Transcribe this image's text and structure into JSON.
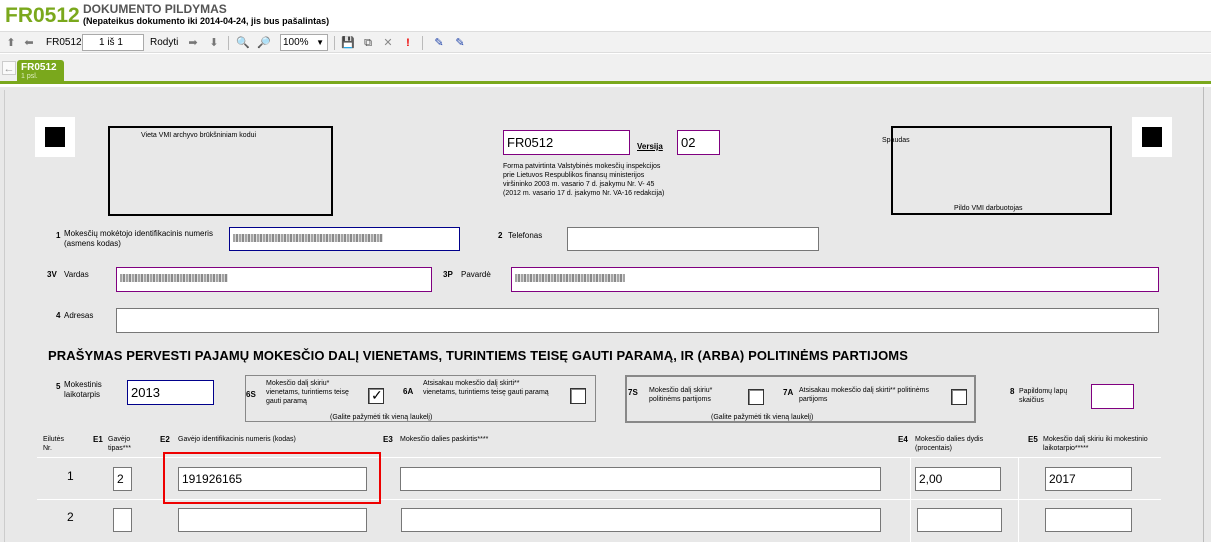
{
  "header": {
    "form_code": "FR0512",
    "title": "DOKUMENTO PILDYMAS",
    "subtitle": "(Nepateikus dokumento iki 2014-04-24, jis bus pašalintas)"
  },
  "toolbar": {
    "form_label": "FR0512",
    "page_value": "1 iš 1",
    "show_label": "Rodyti",
    "zoom_value": "100%"
  },
  "tabs": [
    {
      "label": "FR0512",
      "sub": "1 psl."
    }
  ],
  "form": {
    "archive_label": "Vieta VMI archyvo brūkšniniam kodui",
    "form_code_value": "FR0512",
    "version_label": "Versija",
    "version_value": "02",
    "approval_text": [
      "Forma patvirtinta Valstybinės mokesčių inspekcijos",
      "prie Lietuvos Respublikos finansų ministerijos",
      "viršininko 2003 m. vasario 7 d. įsakymu Nr. V- 45",
      "(2012 m. vasario 17 d. įsakymo Nr. VA-16 redakcija)"
    ],
    "stamp_label": "Spaudas",
    "filled_by_vmi": "Pildo VMI darbuotojas",
    "f1_num": "1",
    "f1_label": "Mokesčių mokėtojo identifikacinis numeris (asmens kodas)",
    "f2_num": "2",
    "f2_label": "Telefonas",
    "f3v_num": "3V",
    "f3v_label": "Vardas",
    "f3p_num": "3P",
    "f3p_label": "Pavardė",
    "f4_num": "4",
    "f4_label": "Adresas",
    "heading": "PRAŠYMAS PERVESTI PAJAMŲ MOKESČIO DALĮ VIENETAMS, TURINTIEMS TEISĘ GAUTI PARAMĄ, IR (ARBA) POLITINĖMS PARTIJOMS",
    "f5_num": "5",
    "f5_label": "Mokestinis laikotarpis",
    "f5_value": "2013",
    "f6s_num": "6S",
    "f6s_label": "Mokesčio dalį skiriu* vienetams, turintiems teisę gauti paramą",
    "f6a_num": "6A",
    "f6a_label": "Atsisakau mokesčio dalį skirti** vienetams, turintiems teisę gauti paramą",
    "group_note": "(Galite pažymėti tik vieną laukelį)",
    "f7s_num": "7S",
    "f7s_label": "Mokesčio dalį skiriu* politinėms partijoms",
    "f7a_num": "7A",
    "f7a_label": "Atsisakau mokesčio dalį skirti** politinėms partijoms",
    "f8_num": "8",
    "f8_label": "Papildomų lapų skaičius",
    "col_row_label": "Eilutės Nr.",
    "col_e1_num": "E1",
    "col_e1": "Gavėjo tipas***",
    "col_e2_num": "E2",
    "col_e2": "Gavėjo identifikacinis numeris (kodas)",
    "col_e3_num": "E3",
    "col_e3": "Mokesčio dalies paskirtis****",
    "col_e4_num": "E4",
    "col_e4": "Mokesčio dalies dydis (procentais)",
    "col_e5_num": "E5",
    "col_e5": "Mokesčio dalį skiriu iki mokestinio laikotarpio*****",
    "rows": [
      {
        "nr": "1",
        "type": "2",
        "code": "191926165",
        "purpose": "",
        "percent": "2,00",
        "until": "2017"
      },
      {
        "nr": "2",
        "type": "",
        "code": "",
        "purpose": "",
        "percent": "",
        "until": ""
      }
    ]
  },
  "colors": {
    "brand_green": "#7aa81c",
    "highlight_red": "#e00000"
  }
}
